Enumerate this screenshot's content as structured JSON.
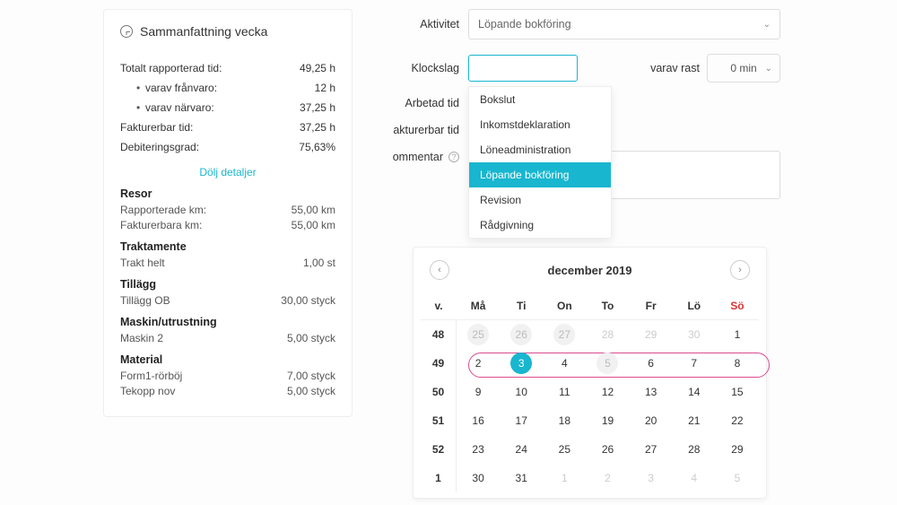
{
  "summary": {
    "title": "Sammanfattning vecka",
    "stats": {
      "total_label": "Totalt rapporterad tid:",
      "total_val": "49,25 h",
      "absence_label": "varav frånvaro:",
      "absence_val": "12 h",
      "presence_label": "varav närvaro:",
      "presence_val": "37,25 h",
      "billable_label": "Fakturerbar tid:",
      "billable_val": "37,25 h",
      "debit_label": "Debiteringsgrad:",
      "debit_val": "75,63%"
    },
    "toggle": "Dölj detaljer",
    "sections": {
      "resor": {
        "title": "Resor",
        "rows": [
          {
            "l": "Rapporterade km:",
            "v": "55,00 km"
          },
          {
            "l": "Fakturerbara km:",
            "v": "55,00 km"
          }
        ]
      },
      "trakt": {
        "title": "Traktamente",
        "rows": [
          {
            "l": "Trakt helt",
            "v": "1,00 st"
          }
        ]
      },
      "tillagg": {
        "title": "Tillägg",
        "rows": [
          {
            "l": "Tillägg OB",
            "v": "30,00 styck"
          }
        ]
      },
      "maskin": {
        "title": "Maskin/utrustning",
        "rows": [
          {
            "l": "Maskin 2",
            "v": "5,00 styck"
          }
        ]
      },
      "material": {
        "title": "Material",
        "rows": [
          {
            "l": "Form1-rörböj",
            "v": "7,00 styck"
          },
          {
            "l": "Tekopp nov",
            "v": "5,00 styck"
          }
        ]
      }
    }
  },
  "form": {
    "activity": {
      "label": "Aktivitet",
      "value": "Löpande bokföring"
    },
    "clock": {
      "label": "Klockslag",
      "search_value": ""
    },
    "rast": {
      "label": "varav rast",
      "value": "0 min"
    },
    "worked": {
      "label": "Arbetad tid"
    },
    "billable": {
      "label": "akturerbar tid"
    },
    "comment": {
      "label": "ommentar"
    },
    "dropdown": [
      {
        "t": "Bokslut",
        "sel": false
      },
      {
        "t": "Inkomstdeklaration",
        "sel": false
      },
      {
        "t": "Löneadministration",
        "sel": false
      },
      {
        "t": "Löpande bokföring",
        "sel": true
      },
      {
        "t": "Revision",
        "sel": false
      },
      {
        "t": "Rådgivning",
        "sel": false
      }
    ]
  },
  "calendar": {
    "title": "december 2019",
    "dow": [
      "v.",
      "Må",
      "Ti",
      "On",
      "To",
      "Fr",
      "Lö",
      "Sö"
    ],
    "weeks": [
      {
        "num": "48",
        "days": [
          "25",
          "26",
          "27",
          "28",
          "29",
          "30",
          "1"
        ],
        "outsideCount": 6,
        "offDays": [
          0,
          1,
          2
        ]
      },
      {
        "num": "49",
        "days": [
          "2",
          "3",
          "4",
          "5",
          "6",
          "7",
          "8"
        ],
        "today": [
          1
        ],
        "offDays": [
          3
        ],
        "selectedRow": true
      },
      {
        "num": "50",
        "days": [
          "9",
          "10",
          "11",
          "12",
          "13",
          "14",
          "15"
        ]
      },
      {
        "num": "51",
        "days": [
          "16",
          "17",
          "18",
          "19",
          "20",
          "21",
          "22"
        ]
      },
      {
        "num": "52",
        "days": [
          "23",
          "24",
          "25",
          "26",
          "27",
          "28",
          "29"
        ]
      },
      {
        "num": "1",
        "days": [
          "30",
          "31",
          "1",
          "2",
          "3",
          "4",
          "5"
        ],
        "outsideFrom": 2
      }
    ]
  }
}
